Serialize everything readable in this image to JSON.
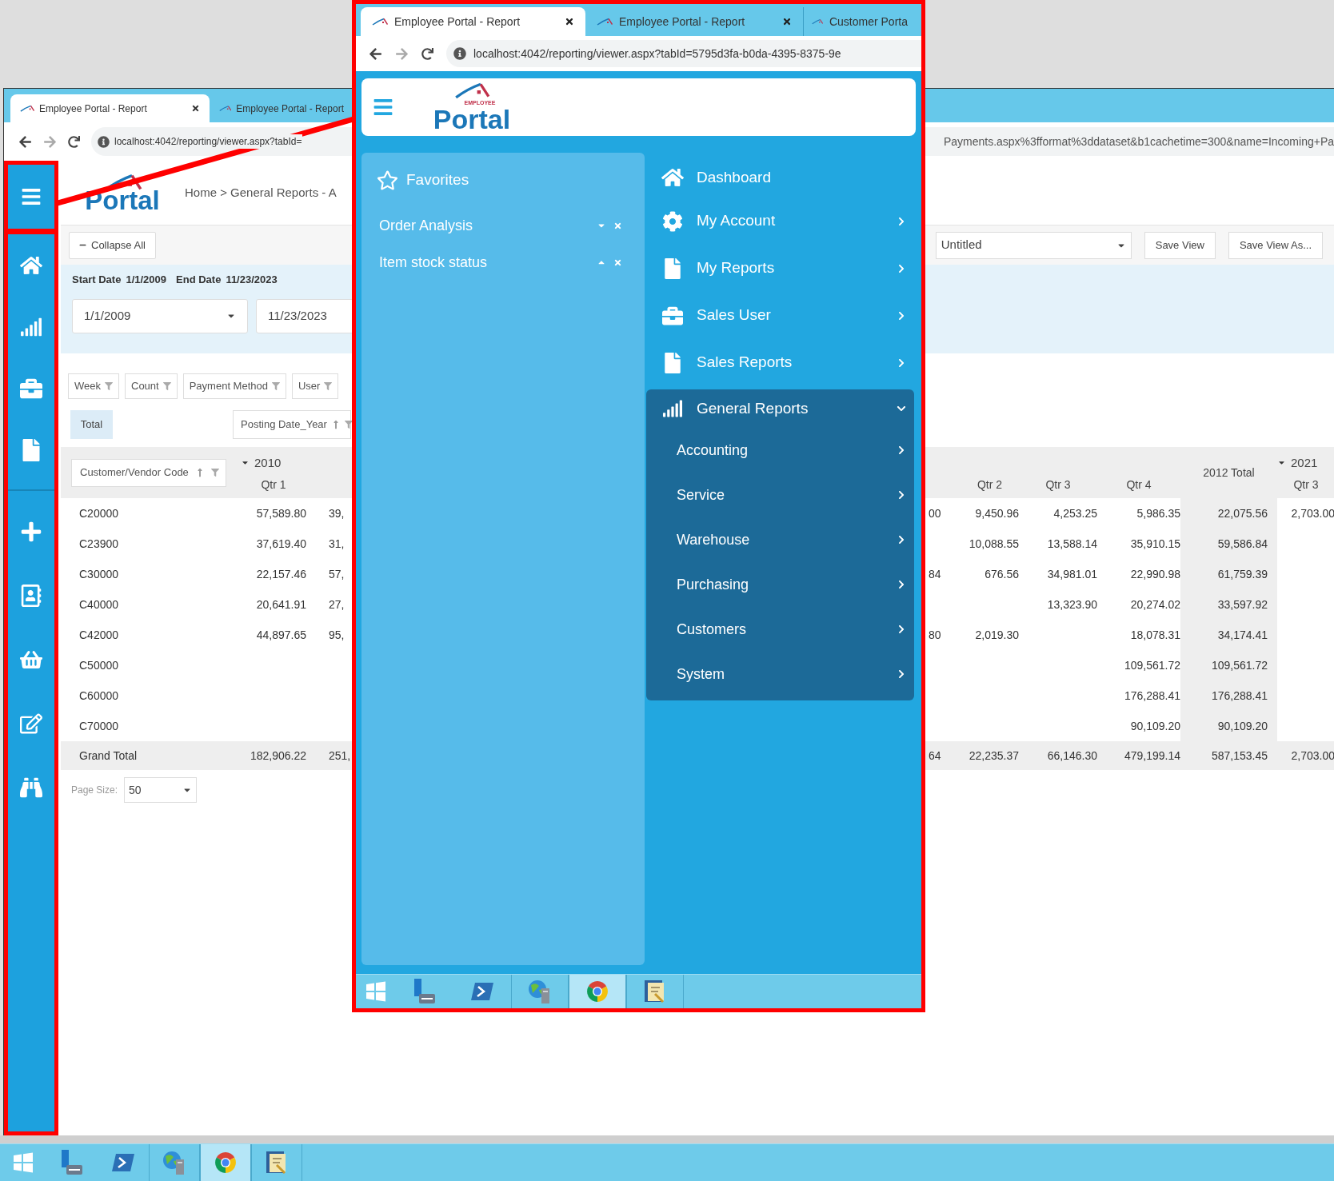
{
  "background": {
    "tabs": [
      {
        "title": "Employee Portal - Report",
        "selected": true
      },
      {
        "title": "Employee Portal - Report",
        "selected": false
      }
    ],
    "address": {
      "start": "localhost:4042/reporting/viewer.aspx?tabId=",
      "end": "Payments.aspx%3fformat%3ddataset&b1cachetime=300&name=Incoming+Pa"
    },
    "logo": "Portal",
    "breadcrumb": "Home > General Reports - A",
    "toolbar": {
      "collapse": "Collapse All",
      "view": "Untitled",
      "buttons": [
        "Save View",
        "Save View As..."
      ]
    },
    "filter": {
      "summary": [
        {
          "label": "Start Date",
          "value": "1/1/2009"
        },
        {
          "label": "End Date",
          "value": "11/23/2023"
        }
      ],
      "fields": [
        "1/1/2009",
        "11/23/2023"
      ]
    },
    "field_chips": [
      "Week",
      "Count",
      "Payment Method",
      "User"
    ],
    "data_chip": "Total",
    "column_chip": "Posting Date_Year",
    "row_chip": "Customer/Vendor Code",
    "columns": [
      {
        "label": "Qtr 1",
        "kind": "quarter",
        "year": {
          "label": "2010",
          "expanded": true
        }
      },
      {
        "kind": "quarter"
      },
      {
        "kind": "quarter"
      },
      {
        "label": "Qtr 2",
        "kind": "quarter"
      },
      {
        "label": "Qtr 3",
        "kind": "quarter"
      },
      {
        "label": "Qtr 4",
        "kind": "quarter"
      },
      {
        "label": "2012 Total",
        "kind": "total"
      },
      {
        "label": "Qtr 3",
        "kind": "quarter",
        "year": {
          "label": "2021",
          "expanded": true
        }
      }
    ],
    "rows": [
      {
        "code": "C20000",
        "cells": [
          "57,589.80",
          "39,",
          "00",
          "9,450.96",
          "4,253.25",
          "5,986.35",
          "22,075.56",
          "2,703.00"
        ]
      },
      {
        "code": "C23900",
        "cells": [
          "37,619.40",
          "31,",
          null,
          "10,088.55",
          "13,588.14",
          "35,910.15",
          "59,586.84",
          null
        ]
      },
      {
        "code": "C30000",
        "cells": [
          "22,157.46",
          "57,",
          "84",
          "676.56",
          "34,981.01",
          "22,990.98",
          "61,759.39",
          null
        ]
      },
      {
        "code": "C40000",
        "cells": [
          "20,641.91",
          "27,",
          null,
          null,
          "13,323.90",
          "20,274.02",
          "33,597.92",
          null
        ]
      },
      {
        "code": "C42000",
        "cells": [
          "44,897.65",
          "95,",
          "80",
          "2,019.30",
          null,
          "18,078.31",
          "34,174.41",
          null
        ]
      },
      {
        "code": "C50000",
        "cells": [
          null,
          null,
          null,
          null,
          null,
          "109,561.72",
          "109,561.72",
          null
        ]
      },
      {
        "code": "C60000",
        "cells": [
          null,
          null,
          null,
          null,
          null,
          "176,288.41",
          "176,288.41",
          null
        ]
      },
      {
        "code": "C70000",
        "cells": [
          null,
          null,
          null,
          null,
          null,
          "90,109.20",
          "90,109.20",
          null
        ]
      }
    ],
    "grand_total": {
      "label": "Grand Total",
      "cells": [
        "182,906.22",
        "251,",
        "64",
        "22,235.37",
        "66,146.30",
        "479,199.14",
        "587,153.45",
        "2,703.00"
      ]
    },
    "page_size": {
      "label": "Page Size:",
      "value": "50"
    }
  },
  "popup": {
    "tabs": [
      {
        "title": "Employee Portal - Report",
        "selected": true
      },
      {
        "title": "Employee Portal - Report",
        "selected": false
      },
      {
        "title": "Customer Porta",
        "selected": false
      }
    ],
    "address": "localhost:4042/reporting/viewer.aspx?tabId=5795d3fa-b0da-4395-8375-9e",
    "logo": {
      "small": "EMPLOYEE",
      "large": "Portal"
    },
    "favorites": {
      "title": "Favorites",
      "items": [
        {
          "label": "Order Analysis",
          "kind": "move_down"
        },
        {
          "label": "Item stock status",
          "kind": "move_up"
        }
      ]
    },
    "nav": [
      {
        "label": "Dashboard",
        "kind": "link"
      },
      {
        "label": "My Account",
        "kind": "group",
        "expanded": false
      },
      {
        "label": "My Reports",
        "kind": "group",
        "expanded": false
      },
      {
        "label": "Sales User",
        "kind": "group",
        "expanded": false
      },
      {
        "label": "Sales Reports",
        "kind": "group",
        "expanded": false
      },
      {
        "label": "General Reports",
        "kind": "group",
        "expanded": true,
        "children": [
          {
            "label": "Accounting",
            "expanded": false
          },
          {
            "label": "Service",
            "expanded": false
          },
          {
            "label": "Warehouse",
            "expanded": false
          },
          {
            "label": "Purchasing",
            "expanded": false
          },
          {
            "label": "Customers",
            "expanded": false
          },
          {
            "label": "System",
            "expanded": false
          }
        ]
      }
    ],
    "taskbar": [
      {
        "kind": "start",
        "running": false,
        "selected": false
      },
      {
        "kind": "server",
        "running": false,
        "selected": false
      },
      {
        "kind": "shell",
        "running": false,
        "selected": false
      },
      {
        "kind": "globe",
        "running": true,
        "selected": false
      },
      {
        "kind": "browser",
        "running": true,
        "selected": true
      },
      {
        "kind": "notes",
        "running": true,
        "selected": false
      }
    ]
  },
  "taskbar": [
    {
      "kind": "start",
      "running": false,
      "selected": false
    },
    {
      "kind": "server",
      "running": false,
      "selected": false
    },
    {
      "kind": "shell",
      "running": false,
      "selected": false
    },
    {
      "kind": "globe",
      "running": true,
      "selected": false
    },
    {
      "kind": "browser",
      "running": true,
      "selected": true
    },
    {
      "kind": "notes",
      "running": true,
      "selected": false
    }
  ]
}
